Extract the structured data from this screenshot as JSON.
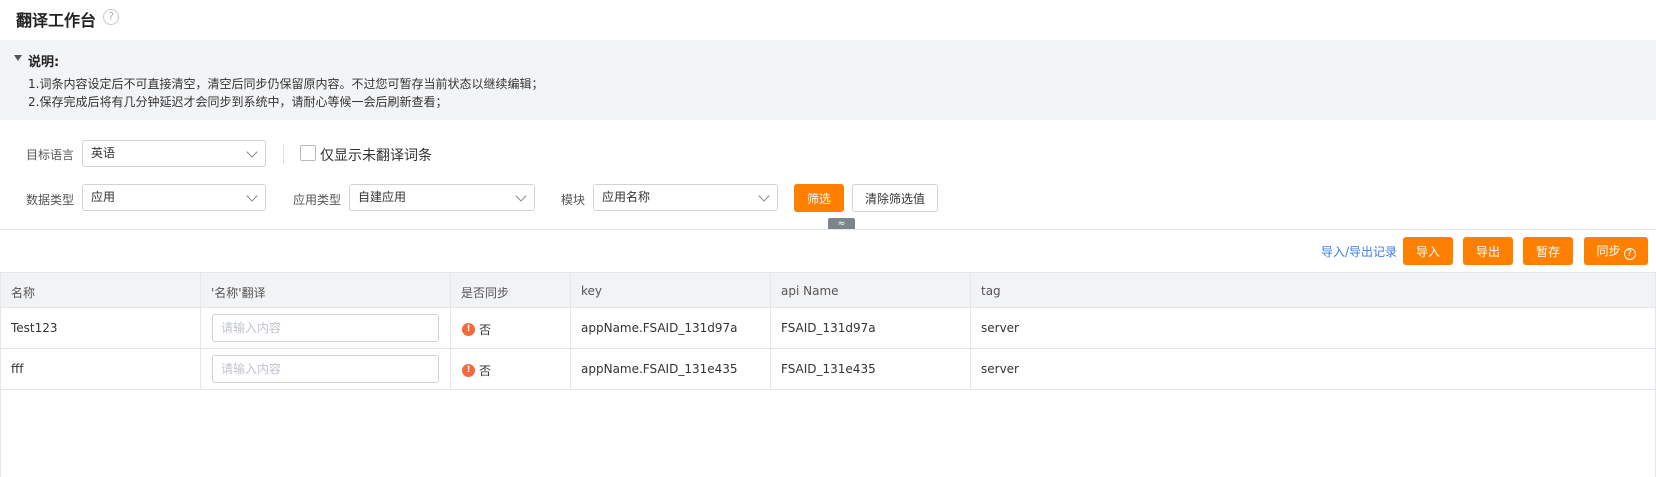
{
  "header": {
    "title": "翻译工作台",
    "help_icon": "?"
  },
  "notice": {
    "title": "说明:",
    "lines": [
      "1.词条内容设定后不可直接清空，清空后同步仍保留原内容。不过您可暂存当前状态以继续编辑；",
      "2.保存完成后将有几分钟延迟才会同步到系统中，请耐心等候一会后刷新查看；"
    ]
  },
  "filters": {
    "target_language_label": "目标语言",
    "target_language_value": "英语",
    "only_untranslated_label": "仅显示未翻译词条",
    "data_type_label": "数据类型",
    "data_type_value": "应用",
    "app_type_label": "应用类型",
    "app_type_value": "自建应用",
    "module_label": "模块",
    "module_value": "应用名称",
    "filter_button": "筛选",
    "clear_button": "清除筛选值",
    "collapse_icon": "≈"
  },
  "toolbar": {
    "history_link": "导入/导出记录",
    "import_button": "导入",
    "export_button": "导出",
    "save_draft_button": "暂存",
    "sync_button": "同步",
    "sync_help_icon": "?"
  },
  "table": {
    "columns": [
      "名称",
      "'名称'翻译",
      "是否同步",
      "key",
      "api Name",
      "tag"
    ],
    "input_placeholder": "请输入内容",
    "warn_icon": "!",
    "rows": [
      {
        "name": "Test123",
        "translation": "",
        "synced": "否",
        "key": "appName.FSAID_131d97a",
        "api_name": "FSAID_131d97a",
        "tag": "server"
      },
      {
        "name": "fff",
        "translation": "",
        "synced": "否",
        "key": "appName.FSAID_131e435",
        "api_name": "FSAID_131e435",
        "tag": "server"
      }
    ]
  },
  "colors": {
    "primary": "#ff8000",
    "link": "#3a7ee8",
    "warning": "#f26a3c",
    "notice_bg": "#f3f4f6",
    "header_bg": "#f2f3f5"
  }
}
